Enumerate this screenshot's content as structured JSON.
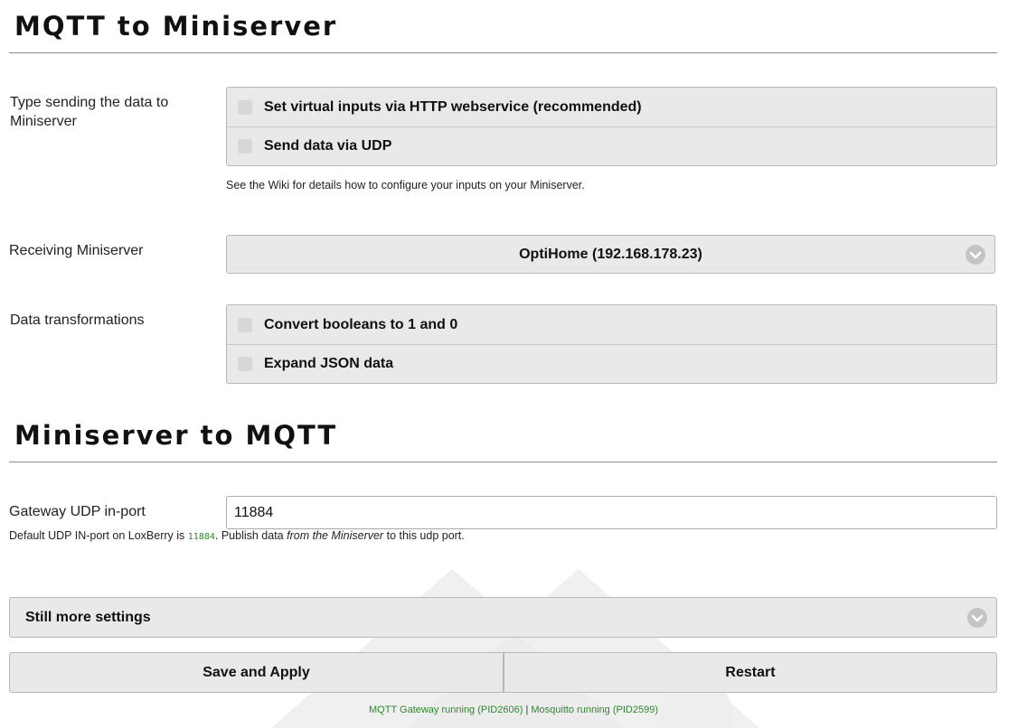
{
  "section1": {
    "title": "MQTT to Miniserver",
    "type_label": "Type sending the data to Miniserver",
    "type_options": [
      {
        "label": "Set virtual inputs via HTTP webservice (recommended)",
        "checked": false
      },
      {
        "label": "Send data via UDP",
        "checked": false
      }
    ],
    "type_hint": "See the Wiki for details how to configure your inputs on your Miniserver.",
    "receiving_label": "Receiving Miniserver",
    "receiving_value": "OptiHome (192.168.178.23)",
    "transform_label": "Data transformations",
    "transform_options": [
      {
        "label": "Convert booleans to 1 and 0",
        "checked": false
      },
      {
        "label": "Expand JSON data",
        "checked": false
      }
    ]
  },
  "section2": {
    "title": "Miniserver to MQTT",
    "udp_label": "Gateway UDP in-port",
    "udp_value": "11884",
    "udp_hint_prefix": "Default UDP IN-port on LoxBerry is",
    "udp_hint_code": "11884",
    "udp_hint_mid": ". Publish data",
    "udp_hint_em": "from the Miniserver",
    "udp_hint_suffix": "to this udp port."
  },
  "more_settings": {
    "label": "Still more settings"
  },
  "buttons": {
    "save": "Save and Apply",
    "restart": "Restart"
  },
  "status": {
    "gateway": "MQTT Gateway running (PID2606)",
    "separator": "|",
    "mosquitto": "Mosquitto running (PID2599)"
  },
  "colors": {
    "status_green": "#2a8a2a",
    "panel_bg": "#e9e9e9"
  },
  "icons": {
    "dropdown": "chevron-down-icon",
    "watermark": "loxberry-logo-watermark"
  }
}
